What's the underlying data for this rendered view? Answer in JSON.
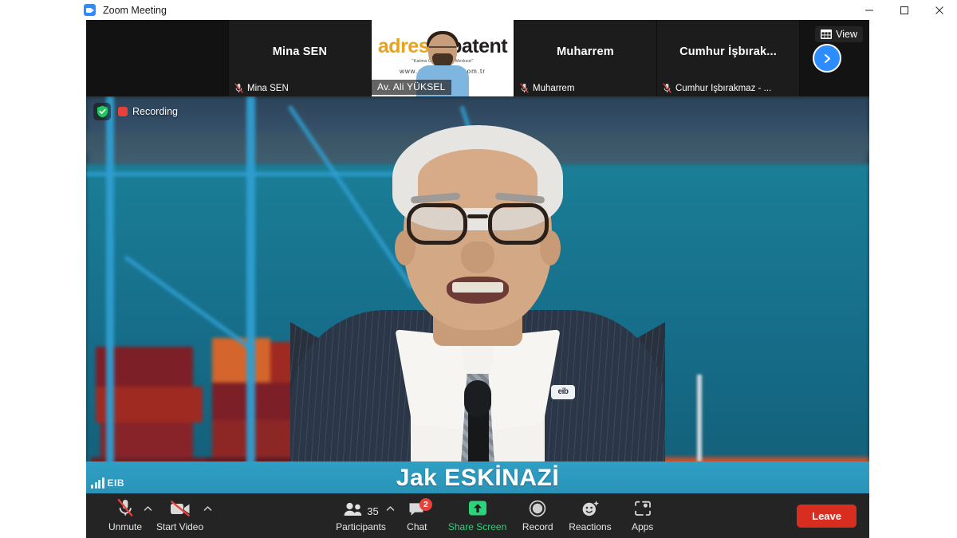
{
  "window": {
    "title": "Zoom Meeting",
    "app_icon": "zoom-icon",
    "controls": {
      "minimize": "minimize-icon",
      "maximize": "maximize-icon",
      "close": "close-icon"
    }
  },
  "filmstrip": {
    "view_button": {
      "label": "View",
      "icon": "grid-view-icon"
    },
    "next_button": {
      "icon": "chevron-right-icon"
    },
    "tiles": [
      {
        "display_name": "",
        "footer_name": "",
        "muted": false,
        "has_video": false,
        "blank": true
      },
      {
        "display_name": "Mina SEN",
        "footer_name": "Mina SEN",
        "muted": true,
        "has_video": false,
        "blank": false
      },
      {
        "display_name": "",
        "footer_name": "Av. Ali YÜKSEL",
        "muted": false,
        "has_video": true,
        "blank": false,
        "logo": {
          "word1": "adres",
          "word2": "patent",
          "tagline": "\"Katma Değerli Fikri Merkezi\"",
          "url": "www.adrespatent.com.tr"
        }
      },
      {
        "display_name": "Muharrem",
        "footer_name": "Muharrem",
        "muted": true,
        "has_video": false,
        "blank": false
      },
      {
        "display_name": "Cumhur  İşbırak...",
        "footer_name": "Cumhur İşbırakmaz - ...",
        "muted": true,
        "has_video": false,
        "blank": false
      }
    ]
  },
  "stage": {
    "encryption_icon": "shield-check-icon",
    "recording_label": "Recording",
    "recording_icon": "record-stop-icon",
    "speaker_name": "Jak ESKİNAZİ",
    "watermark": "EIB",
    "lapel_pin": "eib",
    "banner_color": "#2f9fc4"
  },
  "toolbar": {
    "background": "#242424",
    "items": [
      {
        "name": "unmute",
        "label": "Unmute",
        "icon": "mic-off-icon",
        "caret": true,
        "badge": null,
        "highlight": false
      },
      {
        "name": "start-video",
        "label": "Start Video",
        "icon": "video-off-icon",
        "caret": true,
        "badge": null,
        "highlight": false
      },
      {
        "name": "participants",
        "label": "Participants",
        "icon": "participants-icon",
        "caret": true,
        "badge": null,
        "count": "35",
        "highlight": false
      },
      {
        "name": "chat",
        "label": "Chat",
        "icon": "chat-icon",
        "caret": false,
        "badge": "2",
        "highlight": false
      },
      {
        "name": "share-screen",
        "label": "Share Screen",
        "icon": "share-screen-icon",
        "caret": false,
        "badge": null,
        "highlight": true
      },
      {
        "name": "record",
        "label": "Record",
        "icon": "record-icon",
        "caret": false,
        "badge": null,
        "highlight": false
      },
      {
        "name": "reactions",
        "label": "Reactions",
        "icon": "reactions-icon",
        "caret": false,
        "badge": null,
        "highlight": false
      },
      {
        "name": "apps",
        "label": "Apps",
        "icon": "apps-icon",
        "caret": false,
        "badge": null,
        "highlight": false
      }
    ],
    "leave_label": "Leave",
    "leave_color": "#d92d20"
  }
}
